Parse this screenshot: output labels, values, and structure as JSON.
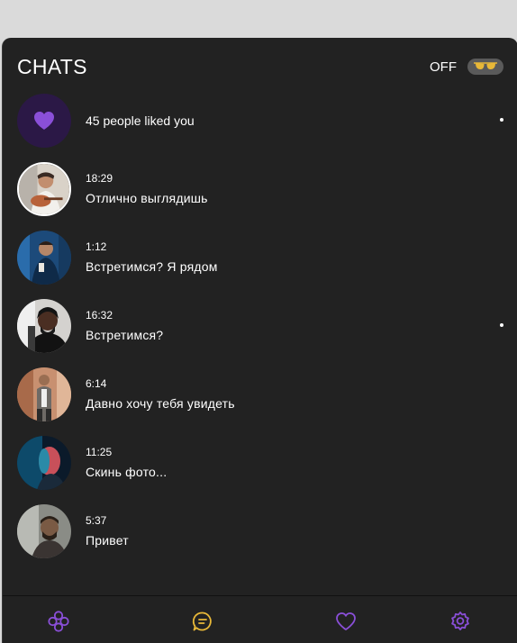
{
  "header": {
    "title": "CHATS",
    "incognito_label": "OFF",
    "toggle_icon": "glasses-icon"
  },
  "likes_row": {
    "text": "45 people liked you",
    "icon": "heart-icon",
    "unread": true
  },
  "chats": [
    {
      "time": "18:29",
      "message": "Отлично выглядишь",
      "unread": false
    },
    {
      "time": "1:12",
      "message": "Встретимся? Я рядом",
      "unread": false
    },
    {
      "time": "16:32",
      "message": "Встретимся?",
      "unread": true
    },
    {
      "time": "6:14",
      "message": "Давно хочу тебя увидеть",
      "unread": false
    },
    {
      "time": "11:25",
      "message": "Скинь фото...",
      "unread": false
    },
    {
      "time": "5:37",
      "message": "Привет",
      "unread": false
    }
  ],
  "nav": [
    {
      "name": "discover",
      "icon": "flower-icon",
      "active": false
    },
    {
      "name": "chats",
      "icon": "chat-bubble-icon",
      "active": true
    },
    {
      "name": "likes",
      "icon": "heart-outline-icon",
      "active": false
    },
    {
      "name": "settings",
      "icon": "gear-icon",
      "active": false
    }
  ],
  "colors": {
    "background": "#222222",
    "accent_purple": "#8a4fd8",
    "accent_yellow": "#e8b838",
    "like_bg": "#2b1846",
    "text": "#ffffff"
  }
}
